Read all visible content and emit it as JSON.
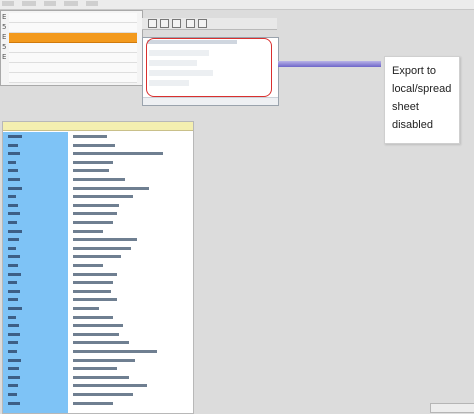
{
  "callout": {
    "text": "Export to local/spread sheet disabled"
  },
  "left_panel": {
    "rows": [
      {
        "num": "",
        "label": "",
        "value": "",
        "selected": false
      },
      {
        "num": "",
        "label": "",
        "value": "",
        "selected": false
      },
      {
        "num": "",
        "label": "",
        "value": "",
        "selected": true
      },
      {
        "num": "",
        "label": "",
        "value": "",
        "selected": false
      },
      {
        "num": "",
        "label": "",
        "value": "",
        "selected": false
      },
      {
        "num": "",
        "label": "",
        "value": "",
        "selected": false
      },
      {
        "num": "",
        "label": "",
        "value": "",
        "selected": false
      }
    ]
  },
  "grid": {
    "row_count": 32
  },
  "colors": {
    "selected_row": "#f39a1e",
    "highlight_border": "#d9302f",
    "key_column": "#7ec3f6",
    "header": "#f4efb0"
  },
  "icons": [
    "export-icon",
    "print-icon",
    "filter-icon"
  ]
}
